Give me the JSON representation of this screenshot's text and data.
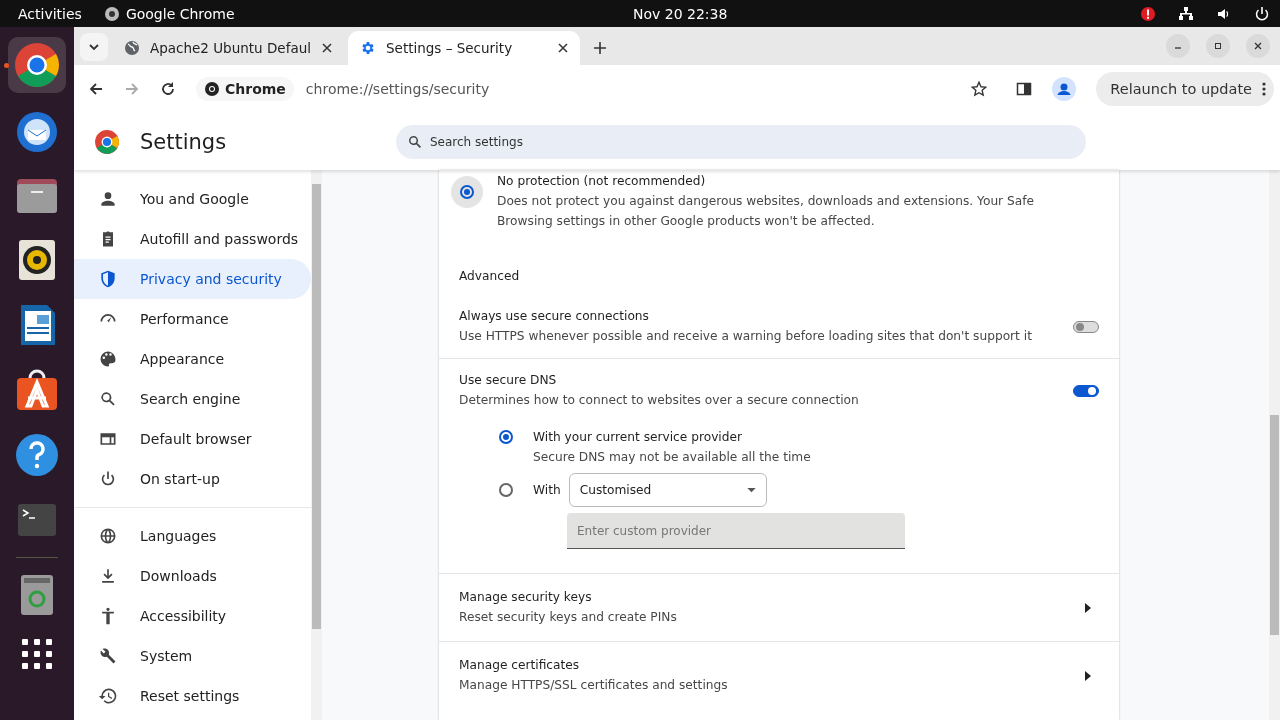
{
  "topbar": {
    "activities": "Activities",
    "app": "Google Chrome",
    "clock": "Nov 20  22:38"
  },
  "dock": [
    {
      "selected": true,
      "running": true
    },
    {
      "selected": false,
      "running": false
    },
    {
      "selected": false,
      "running": false
    },
    {
      "selected": false,
      "running": false
    },
    {
      "selected": false,
      "running": false
    },
    {
      "selected": false,
      "running": false
    },
    {
      "selected": false,
      "running": false
    },
    {
      "selected": false,
      "running": false
    },
    {
      "selected": false,
      "running": false
    }
  ],
  "tabs": [
    {
      "label": "Apache2 Ubuntu Defaul",
      "selected": false,
      "kind": "web"
    },
    {
      "label": "Settings – Security",
      "selected": true,
      "kind": "settings"
    }
  ],
  "toolbar": {
    "chip": "Chrome",
    "url": "chrome://settings/security",
    "relaunch": "Relaunch to update"
  },
  "settings": {
    "title": "Settings",
    "search_placeholder": "Search settings"
  },
  "sidebar": {
    "groups": [
      [
        {
          "label": "You and Google",
          "selected": false
        },
        {
          "label": "Autofill and passwords",
          "selected": false
        },
        {
          "label": "Privacy and security",
          "selected": true
        },
        {
          "label": "Performance",
          "selected": false
        },
        {
          "label": "Appearance",
          "selected": false
        },
        {
          "label": "Search engine",
          "selected": false
        },
        {
          "label": "Default browser",
          "selected": false
        },
        {
          "label": "On start-up",
          "selected": false
        }
      ],
      [
        {
          "label": "Languages",
          "selected": false
        },
        {
          "label": "Downloads",
          "selected": false
        },
        {
          "label": "Accessibility",
          "selected": false
        },
        {
          "label": "System",
          "selected": false
        },
        {
          "label": "Reset settings",
          "selected": false
        }
      ]
    ]
  },
  "content": {
    "protection": {
      "title": "No protection (not recommended)",
      "description": "Does not protect you against dangerous websites, downloads and extensions. Your Safe Browsing settings in other Google products won't be affected.",
      "selected": true
    },
    "advanced": "Advanced",
    "https": {
      "title": "Always use secure connections",
      "description": "Use HTTPS whenever possible and receive a warning before loading sites that don't support it",
      "on": false
    },
    "dns": {
      "title": "Use secure DNS",
      "description": "Determines how to connect to websites over a secure connection",
      "on": true,
      "options": [
        {
          "label": "With your current service provider",
          "description": "Secure DNS may not be available all the time",
          "selected": true
        },
        {
          "label": "With",
          "dropdown": "Customised",
          "placeholder": "Enter custom provider",
          "selected": false
        }
      ]
    },
    "links": [
      {
        "title": "Manage security keys",
        "description": "Reset security keys and create PINs"
      },
      {
        "title": "Manage certificates",
        "description": "Manage HTTPS/SSL certificates and settings"
      }
    ]
  }
}
